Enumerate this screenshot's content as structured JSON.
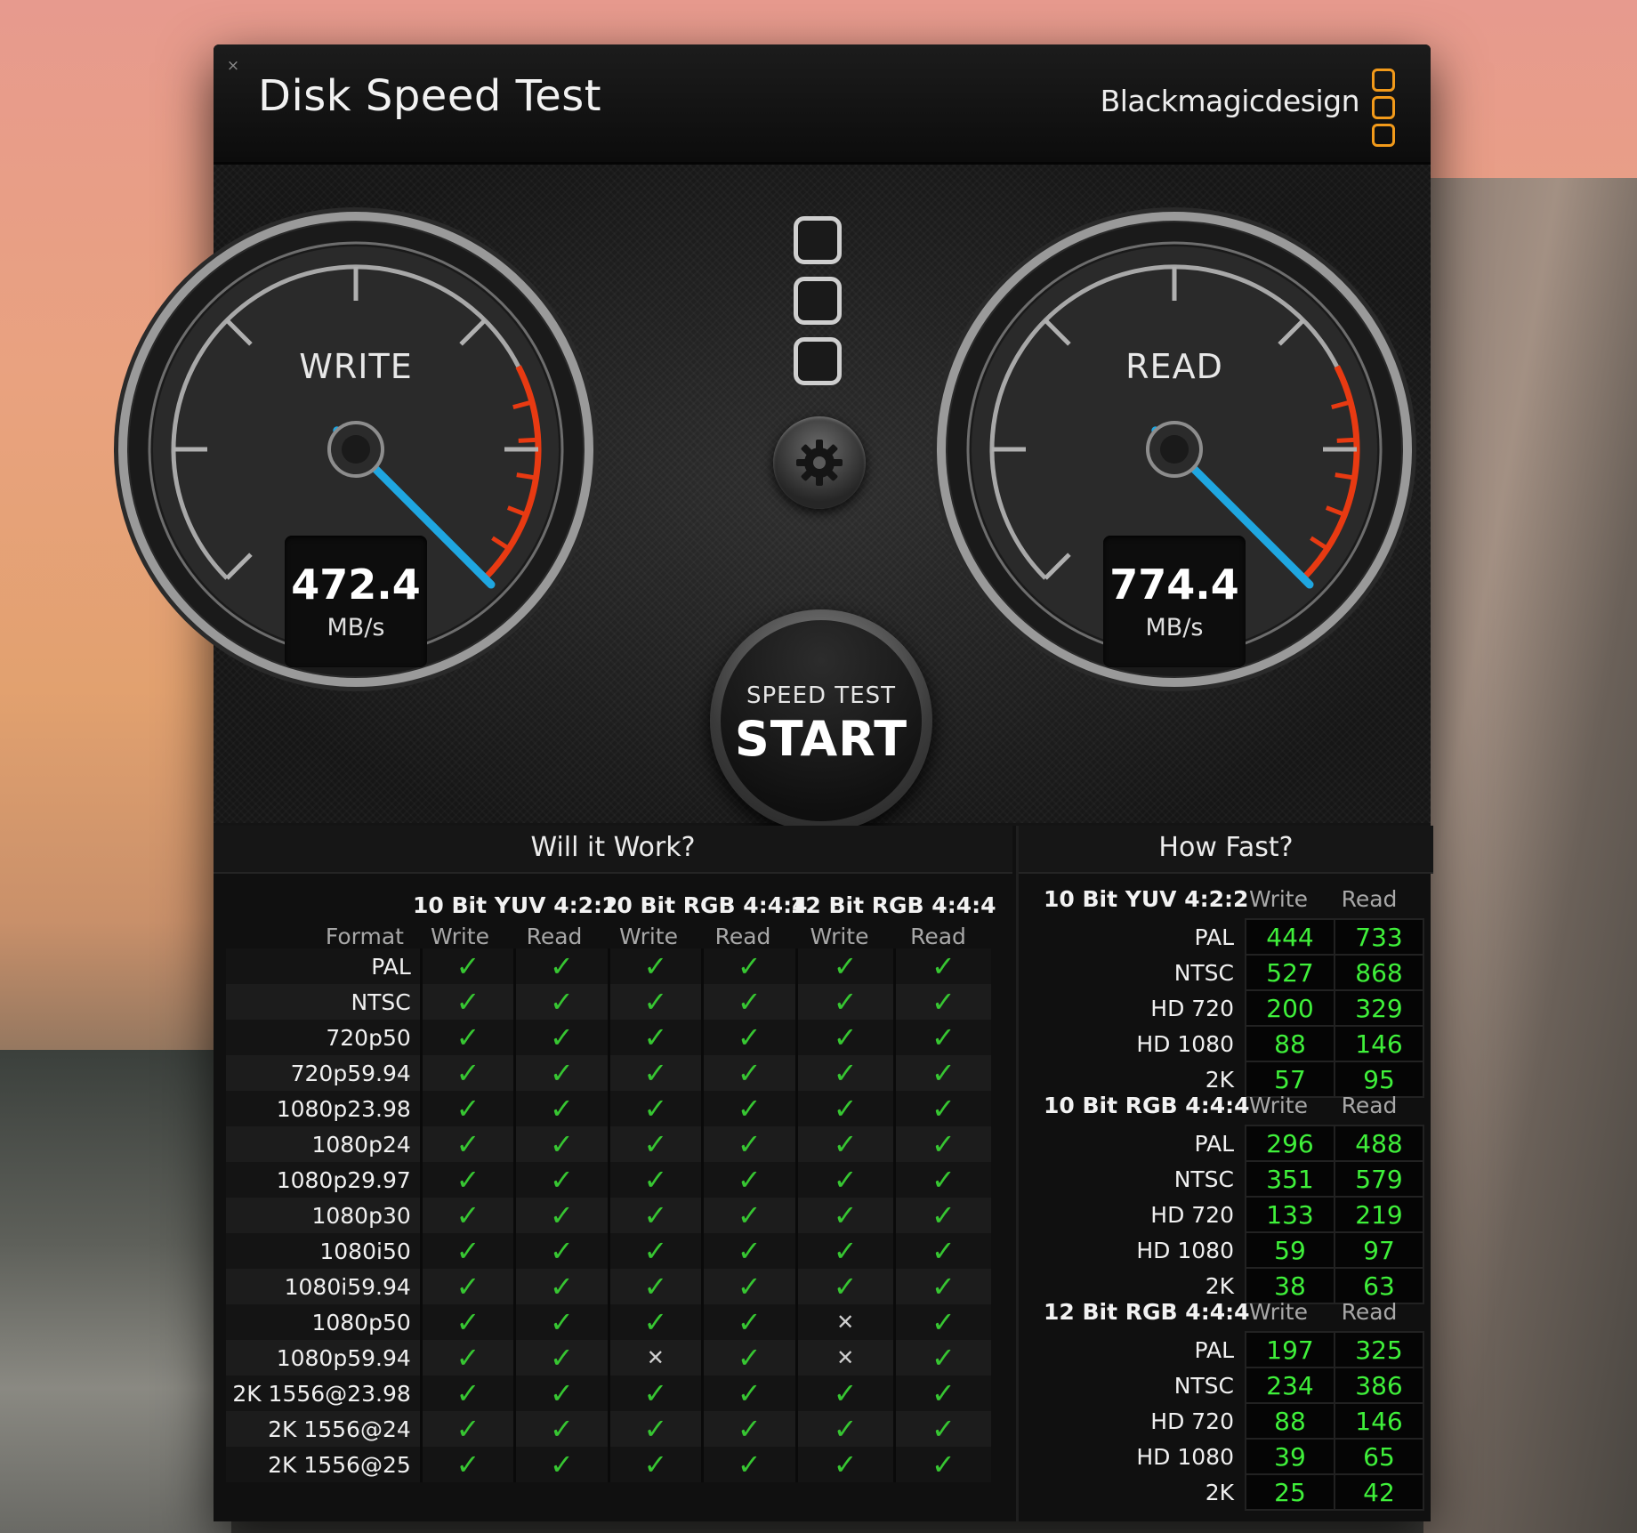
{
  "window": {
    "title": "Disk Speed Test",
    "close_icon": "×",
    "brand": "Blackmagicdesign"
  },
  "gauges": {
    "write": {
      "label": "WRITE",
      "value": "472.4",
      "unit": "MB/s"
    },
    "read": {
      "label": "READ",
      "value": "774.4",
      "unit": "MB/s"
    },
    "needle_color": "#1fa6e0",
    "redline_color": "#e83a12"
  },
  "start_button": {
    "sub": "SPEED TEST",
    "main": "START"
  },
  "will_it_work": {
    "title": "Will it Work?",
    "format_label": "Format",
    "groups": [
      "10 Bit YUV 4:2:2",
      "10 Bit RGB 4:4:4",
      "12 Bit RGB 4:4:4"
    ],
    "subcols": [
      "Write",
      "Read",
      "Write",
      "Read",
      "Write",
      "Read"
    ],
    "rows": [
      {
        "format": "PAL",
        "cells": [
          "✓",
          "✓",
          "✓",
          "✓",
          "✓",
          "✓"
        ]
      },
      {
        "format": "NTSC",
        "cells": [
          "✓",
          "✓",
          "✓",
          "✓",
          "✓",
          "✓"
        ]
      },
      {
        "format": "720p50",
        "cells": [
          "✓",
          "✓",
          "✓",
          "✓",
          "✓",
          "✓"
        ]
      },
      {
        "format": "720p59.94",
        "cells": [
          "✓",
          "✓",
          "✓",
          "✓",
          "✓",
          "✓"
        ]
      },
      {
        "format": "1080p23.98",
        "cells": [
          "✓",
          "✓",
          "✓",
          "✓",
          "✓",
          "✓"
        ]
      },
      {
        "format": "1080p24",
        "cells": [
          "✓",
          "✓",
          "✓",
          "✓",
          "✓",
          "✓"
        ]
      },
      {
        "format": "1080p29.97",
        "cells": [
          "✓",
          "✓",
          "✓",
          "✓",
          "✓",
          "✓"
        ]
      },
      {
        "format": "1080p30",
        "cells": [
          "✓",
          "✓",
          "✓",
          "✓",
          "✓",
          "✓"
        ]
      },
      {
        "format": "1080i50",
        "cells": [
          "✓",
          "✓",
          "✓",
          "✓",
          "✓",
          "✓"
        ]
      },
      {
        "format": "1080i59.94",
        "cells": [
          "✓",
          "✓",
          "✓",
          "✓",
          "✓",
          "✓"
        ]
      },
      {
        "format": "1080p50",
        "cells": [
          "✓",
          "✓",
          "✓",
          "✓",
          "✕",
          "✓"
        ]
      },
      {
        "format": "1080p59.94",
        "cells": [
          "✓",
          "✓",
          "✕",
          "✓",
          "✕",
          "✓"
        ]
      },
      {
        "format": "2K 1556@23.98",
        "cells": [
          "✓",
          "✓",
          "✓",
          "✓",
          "✓",
          "✓"
        ]
      },
      {
        "format": "2K 1556@24",
        "cells": [
          "✓",
          "✓",
          "✓",
          "✓",
          "✓",
          "✓"
        ]
      },
      {
        "format": "2K 1556@25",
        "cells": [
          "✓",
          "✓",
          "✓",
          "✓",
          "✓",
          "✓"
        ]
      }
    ]
  },
  "how_fast": {
    "title": "How Fast?",
    "write_label": "Write",
    "read_label": "Read",
    "sections": [
      {
        "name": "10 Bit YUV 4:2:2",
        "rows": [
          {
            "label": "PAL",
            "write": "444",
            "read": "733"
          },
          {
            "label": "NTSC",
            "write": "527",
            "read": "868"
          },
          {
            "label": "HD 720",
            "write": "200",
            "read": "329"
          },
          {
            "label": "HD 1080",
            "write": "88",
            "read": "146"
          },
          {
            "label": "2K",
            "write": "57",
            "read": "95"
          }
        ]
      },
      {
        "name": "10 Bit RGB 4:4:4",
        "rows": [
          {
            "label": "PAL",
            "write": "296",
            "read": "488"
          },
          {
            "label": "NTSC",
            "write": "351",
            "read": "579"
          },
          {
            "label": "HD 720",
            "write": "133",
            "read": "219"
          },
          {
            "label": "HD 1080",
            "write": "59",
            "read": "97"
          },
          {
            "label": "2K",
            "write": "38",
            "read": "63"
          }
        ]
      },
      {
        "name": "12 Bit RGB 4:4:4",
        "rows": [
          {
            "label": "PAL",
            "write": "197",
            "read": "325"
          },
          {
            "label": "NTSC",
            "write": "234",
            "read": "386"
          },
          {
            "label": "HD 720",
            "write": "88",
            "read": "146"
          },
          {
            "label": "HD 1080",
            "write": "39",
            "read": "65"
          },
          {
            "label": "2K",
            "write": "25",
            "read": "42"
          }
        ]
      }
    ]
  }
}
